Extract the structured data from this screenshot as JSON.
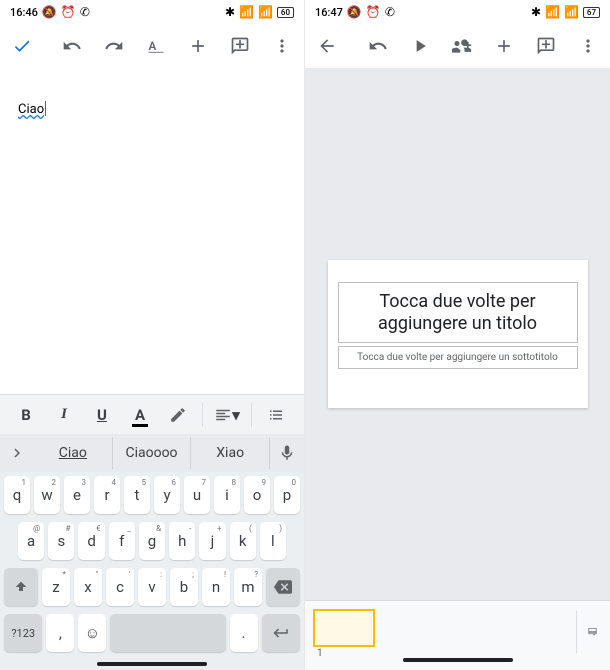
{
  "left": {
    "status": {
      "time": "16:46",
      "battery": "60"
    },
    "document": {
      "text": "Ciao"
    },
    "suggestions": {
      "items": [
        "Ciao",
        "Ciaoooo",
        "Xiao"
      ]
    },
    "keyboard": {
      "row1": [
        {
          "k": "q",
          "s": "1"
        },
        {
          "k": "w",
          "s": "2"
        },
        {
          "k": "e",
          "s": "3"
        },
        {
          "k": "r",
          "s": "4"
        },
        {
          "k": "t",
          "s": "5"
        },
        {
          "k": "y",
          "s": "6"
        },
        {
          "k": "u",
          "s": "7"
        },
        {
          "k": "i",
          "s": "8"
        },
        {
          "k": "o",
          "s": "9"
        },
        {
          "k": "p",
          "s": "0"
        }
      ],
      "row2": [
        {
          "k": "a",
          "s": "@"
        },
        {
          "k": "s",
          "s": "#"
        },
        {
          "k": "d",
          "s": "€"
        },
        {
          "k": "f",
          "s": "_"
        },
        {
          "k": "g",
          "s": "&"
        },
        {
          "k": "h",
          "s": "-"
        },
        {
          "k": "j",
          "s": "+"
        },
        {
          "k": "k",
          "s": "("
        },
        {
          "k": "l",
          "s": ")"
        }
      ],
      "row3": [
        {
          "k": "z",
          "s": "*"
        },
        {
          "k": "x",
          "s": "\""
        },
        {
          "k": "c",
          "s": "'"
        },
        {
          "k": "v",
          "s": ":"
        },
        {
          "k": "b",
          "s": ";"
        },
        {
          "k": "n",
          "s": "!"
        },
        {
          "k": "m",
          "s": "?"
        }
      ],
      "symKey": "?123",
      "commaKey": ",",
      "periodKey": "."
    }
  },
  "right": {
    "status": {
      "time": "16:47",
      "battery": "67"
    },
    "slide": {
      "title_placeholder": "Tocca due volte per aggiungere un titolo",
      "subtitle_placeholder": "Tocca due volte per aggiungere un sottotitolo"
    },
    "thumb_number": "1"
  }
}
